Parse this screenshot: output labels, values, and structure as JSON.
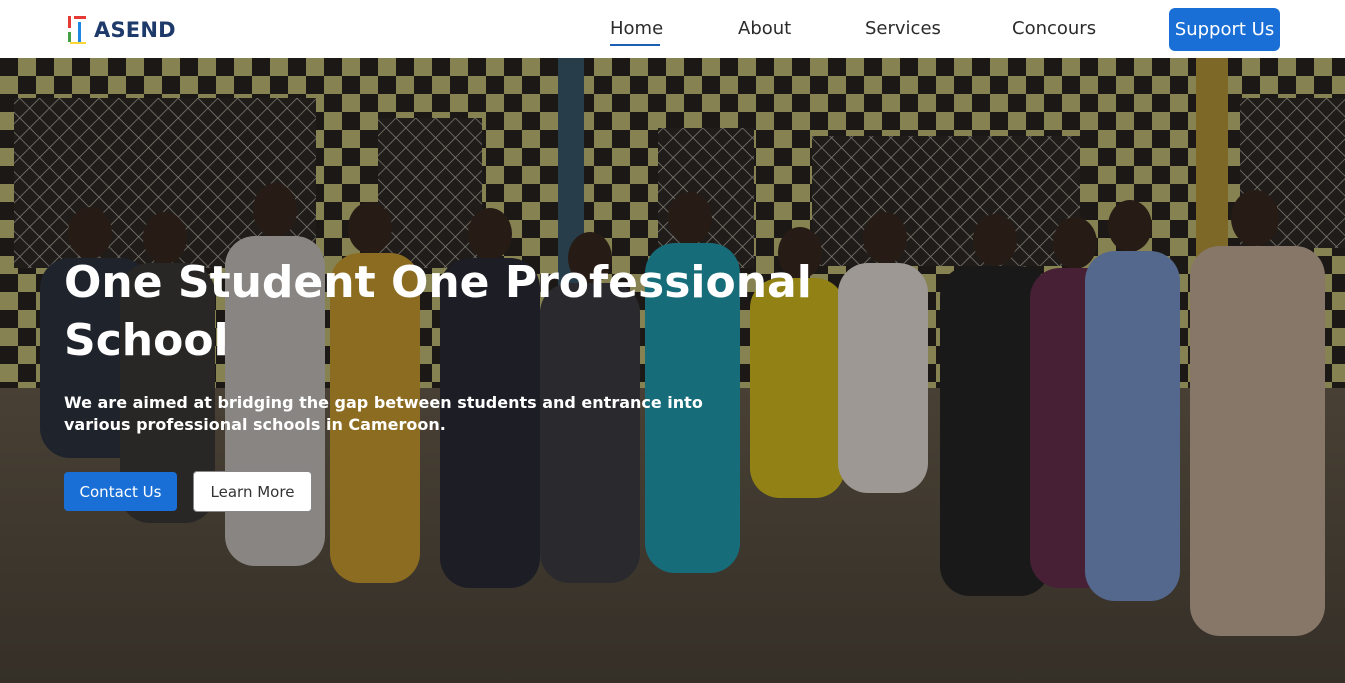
{
  "brand": {
    "name": "ASEND",
    "logo_icon": "asend-logo-icon",
    "colors": [
      "#e53935",
      "#43a047",
      "#1e88e5",
      "#fdd835"
    ]
  },
  "nav": {
    "items": [
      {
        "label": "Home",
        "active": true
      },
      {
        "label": "About",
        "active": false
      },
      {
        "label": "Services",
        "active": false
      },
      {
        "label": "Concours",
        "active": false
      }
    ],
    "cta_label": "Support Us"
  },
  "hero": {
    "title": "One Student One Professional School",
    "subtitle": "We are aimed at bridging the gap between students and entrance into various professional schools in Cameroon.",
    "primary_button": "Contact Us",
    "secondary_button": "Learn More"
  },
  "colors": {
    "accent": "#1a6fd6",
    "brand_text": "#1e3a6b"
  }
}
